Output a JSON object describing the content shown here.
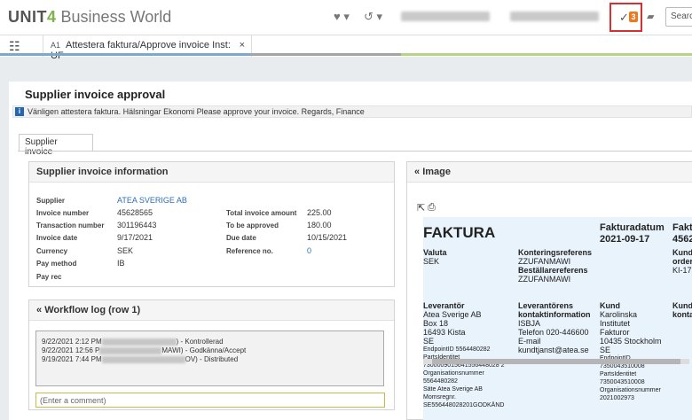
{
  "brand": {
    "unit": "UNIT",
    "four": "4",
    "product": "Business World"
  },
  "header": {
    "heart_icon": "heart-icon",
    "history_icon": "history-icon",
    "task_count": "3",
    "search_label": "Search",
    "chat_icon": "chat-icon"
  },
  "tab": {
    "prefix": "A1",
    "title": "Attestera faktura/Approve invoice Inst: UF",
    "close": "×"
  },
  "page": {
    "title": "Supplier invoice approval",
    "info": "Vänligen attestera faktura. Hälsningar Ekonomi Please approve your invoice. Regards, Finance",
    "sub_tab": "Supplier invoice"
  },
  "info_panel": {
    "title": "Supplier invoice information",
    "left": [
      {
        "label": "Supplier",
        "value": "ATEA SVERIGE AB"
      },
      {
        "label": "Invoice number",
        "value": "45628565"
      },
      {
        "label": "Transaction number",
        "value": "301196443"
      },
      {
        "label": "Invoice date",
        "value": "9/17/2021"
      },
      {
        "label": "Currency",
        "value": "SEK"
      },
      {
        "label": "Pay method",
        "value": "IB"
      },
      {
        "label": "Pay rec",
        "value": ""
      }
    ],
    "right": [
      {
        "label": "Total invoice amount",
        "value": "225.00"
      },
      {
        "label": "To be approved",
        "value": "180.00"
      },
      {
        "label": "Due date",
        "value": "10/15/2021"
      },
      {
        "label": "Reference no.",
        "value": "0"
      }
    ]
  },
  "workflow": {
    "title": "Workflow log (row 1)",
    "entries": [
      {
        "time": "9/22/2021 2:12 PM",
        "action": ") - Kontrollerad"
      },
      {
        "time": "9/22/2021 12:56 P",
        "action": "MAWI) - Godkänna/Accept"
      },
      {
        "time": "9/19/2021 7:44 PM",
        "action": "OV) - Distributed"
      }
    ],
    "comment_placeholder": "(Enter a comment)"
  },
  "image_panel": {
    "title": "Image",
    "invoice": {
      "faktura": "FAKTURA",
      "fakturadatum_label": "Fakturadatum",
      "fakturadatum": "2021-09-17",
      "col3_label": "Fakt",
      "col3_value": "4562",
      "valuta_label": "Valuta",
      "valuta": "SEK",
      "kontering_label": "Konteringsreferens",
      "kontering": "ZZUFANMAWI",
      "bestallare_label": "Beställarereferens",
      "bestallare": "ZZUFANMAWI",
      "kund_short": "Kund",
      "order_short": "order",
      "ki_short": "KI-17",
      "leverantor_label": "Leverantör",
      "leverantor": [
        "Atea Sverige AB",
        "Box 18",
        "16493  Kista",
        "SE"
      ],
      "endpoint_left": [
        "EndpointID  5564480282",
        "PartsIdentitet",
        "7300009015641556448028 2",
        "Organisationsnummer",
        "5564480282",
        "Säte  Atea Sverige AB",
        "Momsregnr.",
        "SE556448028201GODKÄND"
      ],
      "kontakt_label1": "Leverantörens",
      "kontakt_label2": "kontaktinformation",
      "kontakt": [
        "ISBJA",
        "Telefon  020-446600",
        "E-mail",
        "kundtjanst@atea.se"
      ],
      "kund_label": "Kund",
      "kund": [
        "Karolinska",
        "Institutet",
        "Fakturor",
        "10435  Stockholm",
        "SE"
      ],
      "endpoint_right": [
        "EndpointID",
        "7350043510008",
        "PartsIdentitet",
        "7350043510008",
        "Organisationsnummer",
        "2021002973"
      ],
      "kund_col4": "Kund",
      "kontakt_col4": "konta"
    }
  }
}
